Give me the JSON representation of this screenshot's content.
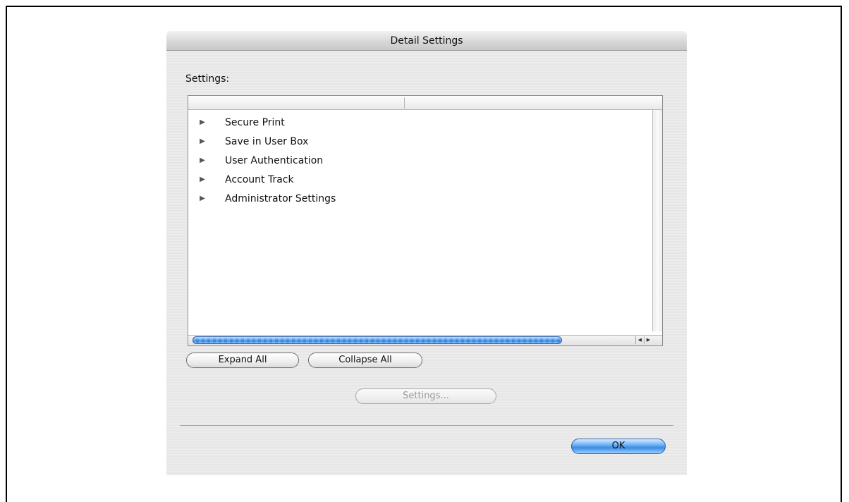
{
  "window": {
    "title": "Detail Settings"
  },
  "settings_label": "Settings:",
  "tree_items": [
    {
      "label": "Secure Print"
    },
    {
      "label": "Save in User Box"
    },
    {
      "label": "User Authentication"
    },
    {
      "label": "Account Track"
    },
    {
      "label": "Administrator Settings"
    }
  ],
  "buttons": {
    "expand_all": "Expand All",
    "collapse_all": "Collapse All",
    "settings": "Settings...",
    "ok": "OK"
  },
  "icons": {
    "tree_arrow": "disclosure-triangle-right-icon",
    "scroll_left": "scroll-left-arrow-icon",
    "scroll_right": "scroll-right-arrow-icon"
  },
  "colors": {
    "accent_blue": "#3a8ae6",
    "window_bg": "#ececec"
  }
}
